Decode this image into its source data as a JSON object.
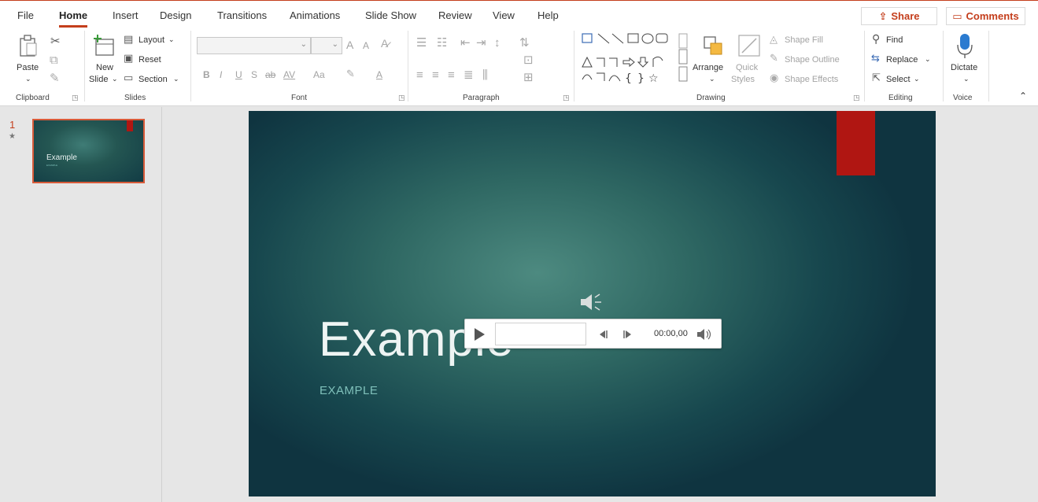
{
  "tabs": [
    {
      "label": "File"
    },
    {
      "label": "Home"
    },
    {
      "label": "Insert"
    },
    {
      "label": "Design"
    },
    {
      "label": "Transitions"
    },
    {
      "label": "Animations"
    },
    {
      "label": "Slide Show"
    },
    {
      "label": "Review"
    },
    {
      "label": "View"
    },
    {
      "label": "Help"
    }
  ],
  "header": {
    "share_label": "Share",
    "comments_label": "Comments"
  },
  "ribbon": {
    "clipboard": {
      "label": "Clipboard",
      "paste": "Paste"
    },
    "slides": {
      "label": "Slides",
      "new_slide_1": "New",
      "new_slide_2": "Slide",
      "layout": "Layout",
      "reset": "Reset",
      "section": "Section"
    },
    "font": {
      "label": "Font",
      "bold": "B",
      "italic": "I",
      "underline": "U",
      "shadow": "S",
      "strike": "ab",
      "spacing": "AV",
      "case": "Aa",
      "grow": "A",
      "shrink": "A",
      "color": "A"
    },
    "paragraph": {
      "label": "Paragraph"
    },
    "drawing": {
      "label": "Drawing",
      "arrange": "Arrange",
      "quick_styles_1": "Quick",
      "quick_styles_2": "Styles",
      "shape_fill": "Shape Fill",
      "shape_outline": "Shape Outline",
      "shape_effects": "Shape Effects"
    },
    "editing": {
      "label": "Editing",
      "find": "Find",
      "replace": "Replace",
      "select": "Select"
    },
    "voice": {
      "label": "Voice",
      "dictate": "Dictate"
    }
  },
  "thumbnails": [
    {
      "number": "1",
      "star": "★",
      "title": "Example",
      "subtitle": "EXAMPLE"
    }
  ],
  "slide": {
    "title": "Example",
    "subtitle": "EXAMPLE",
    "accent_color": "#b01612"
  },
  "player": {
    "time": "00:00,00"
  },
  "colors": {
    "accent": "#c43e1c",
    "slide_bg": "#17474e",
    "subtitle": "#7fc0ba"
  }
}
